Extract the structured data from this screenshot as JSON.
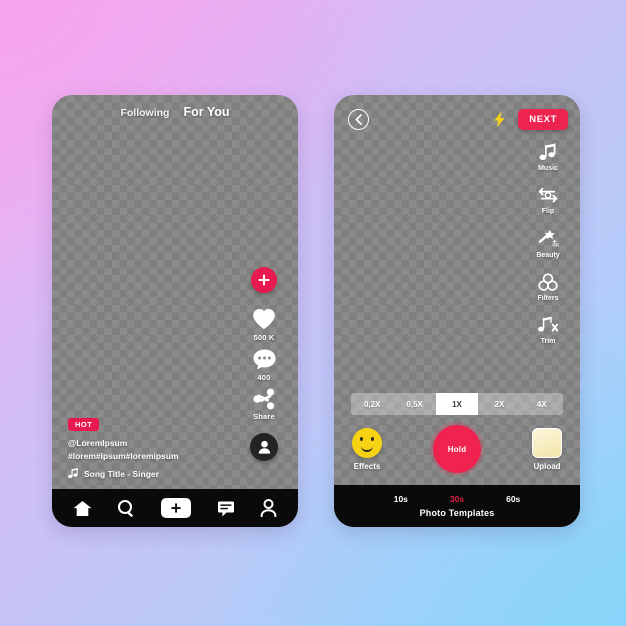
{
  "theme": {
    "accent_red": "#e8194f",
    "next_red": "#ed2350",
    "record_red": "#f0224f",
    "effects_yellow": "#f5d312",
    "bolt_yellow": "#f7d117",
    "bar_black": "#0a0a0a",
    "gradient_top_left": "#f4b1ee",
    "gradient_top_right": "#c6c3f8",
    "gradient_bottom_left": "#c5c4f5",
    "gradient_bottom_right": "#92d4f9"
  },
  "feed_screen": {
    "tabs": [
      {
        "label": "Following",
        "active": false
      },
      {
        "label": "For You",
        "active": true
      }
    ],
    "action_rail": {
      "follow_icon": "plus-icon",
      "items": [
        {
          "icon": "heart-icon",
          "caption": "500 K"
        },
        {
          "icon": "comment-icon",
          "caption": "400"
        },
        {
          "icon": "share-icon",
          "caption": "Share"
        }
      ],
      "avatar_icon": "person-icon"
    },
    "caption": {
      "badge": "HOT",
      "handle": "@LoremIpsum",
      "hashtags": "#lorem#Ipsum#loremipsum",
      "music_icon": "music-note-icon",
      "song": "Song Title - Singer"
    },
    "tabbar": [
      {
        "name": "home",
        "icon": "home-icon",
        "label": "Home"
      },
      {
        "name": "search",
        "icon": "search-icon",
        "label": "Search"
      },
      {
        "name": "create",
        "icon": "plus-icon",
        "label": "Create"
      },
      {
        "name": "inbox",
        "icon": "message-icon",
        "label": "Inbox"
      },
      {
        "name": "profile",
        "icon": "person-icon",
        "label": "Profile"
      }
    ]
  },
  "camera_screen": {
    "top": {
      "back_icon": "chevron-left-icon",
      "flash_icon": "lightning-bolt-icon",
      "next_label": "NEXT"
    },
    "tools": [
      {
        "icon": "music-note-icon",
        "label": "Music"
      },
      {
        "icon": "flip-camera-icon",
        "label": "Flip"
      },
      {
        "icon": "magic-wand-icon",
        "label": "Beauty",
        "state": "OFF"
      },
      {
        "icon": "filters-icon",
        "label": "Filters"
      },
      {
        "icon": "trim-icon",
        "label": "Trim"
      }
    ],
    "speed_options": [
      {
        "label": "0,2X",
        "selected": false
      },
      {
        "label": "0,5X",
        "selected": false
      },
      {
        "label": "1X",
        "selected": true
      },
      {
        "label": "2X",
        "selected": false
      },
      {
        "label": "4X",
        "selected": false
      }
    ],
    "capture": {
      "effects_label": "Effects",
      "effects_icon": "smiley-icon",
      "record_label": "Hold",
      "upload_label": "Upload",
      "upload_icon": "gallery-icon"
    },
    "durations": [
      {
        "label": "10s",
        "selected": false
      },
      {
        "label": "30s",
        "selected": true
      },
      {
        "label": "60s",
        "selected": false
      }
    ],
    "templates_label": "Photo Templates"
  }
}
